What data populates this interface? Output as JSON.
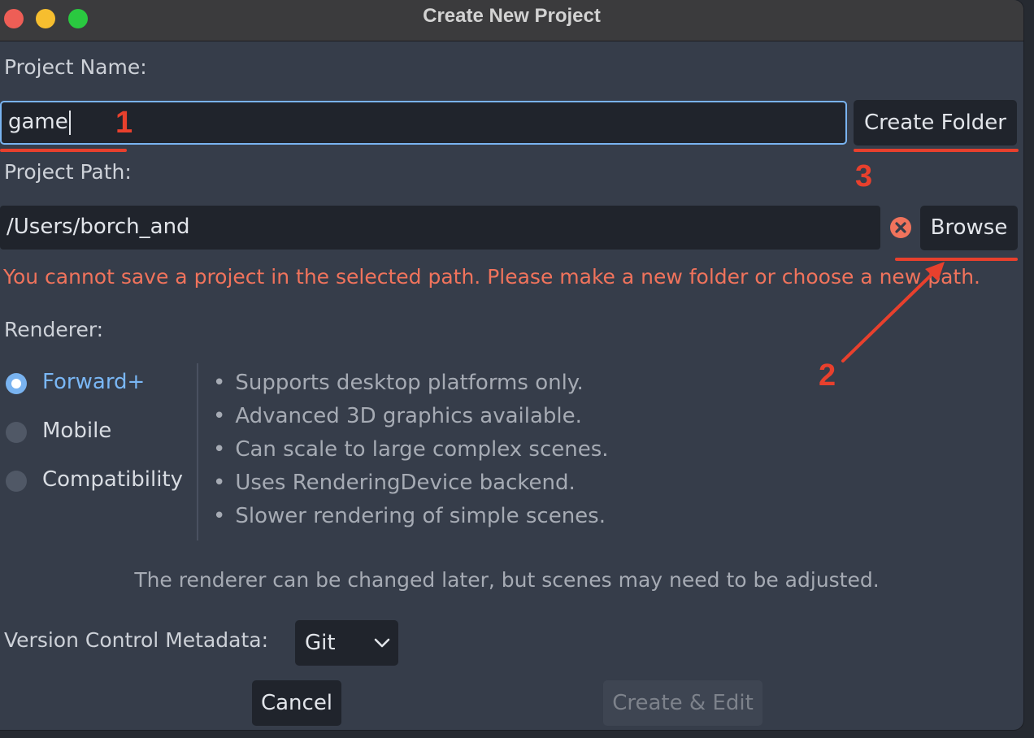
{
  "window": {
    "title": "Create New Project"
  },
  "project_name": {
    "label": "Project Name:",
    "value": "game",
    "create_folder_label": "Create Folder"
  },
  "project_path": {
    "label": "Project Path:",
    "value": "/Users/borch_and",
    "browse_label": "Browse",
    "error_icon": "error-x-icon",
    "error_message": "You cannot save a project in the selected path. Please make a new folder or choose a new path."
  },
  "renderer": {
    "label": "Renderer:",
    "options": [
      {
        "label": "Forward+",
        "selected": true
      },
      {
        "label": "Mobile",
        "selected": false
      },
      {
        "label": "Compatibility",
        "selected": false
      }
    ],
    "features": [
      "Supports desktop platforms only.",
      "Advanced 3D graphics available.",
      "Can scale to large complex scenes.",
      "Uses RenderingDevice backend.",
      "Slower rendering of simple scenes."
    ],
    "bullet": "•",
    "note": "The renderer can be changed later, but scenes may need to be adjusted."
  },
  "version_control": {
    "label": "Version Control Metadata:",
    "selected": "Git"
  },
  "footer": {
    "cancel_label": "Cancel",
    "create_edit_label": "Create & Edit"
  },
  "annotations": {
    "color": "#e8402d",
    "labels": [
      "1",
      "2",
      "3"
    ]
  },
  "colors": {
    "accent": "#79b3f0",
    "error": "#f0735c",
    "panel_bg": "#363d4a",
    "field_bg": "#20242c"
  }
}
